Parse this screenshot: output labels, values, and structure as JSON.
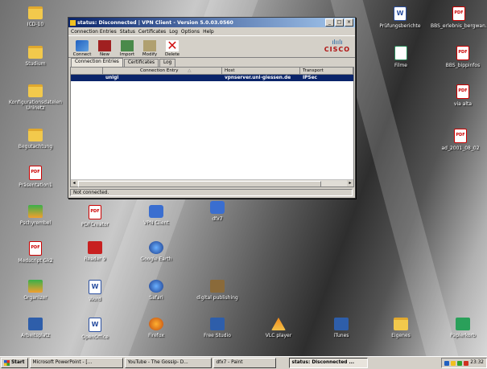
{
  "desktop": {
    "icons": [
      {
        "label": "ICD-10",
        "type": "folder"
      },
      {
        "label": "Studium",
        "type": "folder"
      },
      {
        "label": "Konfigurationsdateien Uninetz",
        "type": "folder"
      },
      {
        "label": "Begutachtung",
        "type": "folder"
      },
      {
        "label": "Präsentation1",
        "type": "pdf"
      },
      {
        "label": "Pschyrembel",
        "type": "green"
      },
      {
        "label": "PDFCreator",
        "type": "pdf"
      },
      {
        "label": "VPN Client",
        "type": "app"
      },
      {
        "label": "dfx7",
        "type": "app"
      },
      {
        "label": "Medscript Gk2",
        "type": "pdf"
      },
      {
        "label": "Reader 9",
        "type": "red"
      },
      {
        "label": "Google Earth",
        "type": "globe"
      },
      {
        "label": "Organizer",
        "type": "green"
      },
      {
        "label": "Word",
        "type": "doc"
      },
      {
        "label": "Safari",
        "type": "globe"
      },
      {
        "label": "digital publishing",
        "type": "brown"
      },
      {
        "label": "Arbeitsplatz",
        "type": "blue"
      },
      {
        "label": "OpenOffice",
        "type": "doc"
      },
      {
        "label": "Firefox",
        "type": "orange"
      },
      {
        "label": "Free Studio",
        "type": "blue"
      },
      {
        "label": "VLC player",
        "type": "cone"
      },
      {
        "label": "iTunes",
        "type": "blue"
      },
      {
        "label": "Eigenes",
        "type": "folder"
      },
      {
        "label": "Papierkorb",
        "type": "recycle"
      },
      {
        "label": "Prüfungsberichte",
        "type": "doc"
      },
      {
        "label": "BBS_erlebnis_bergwan...",
        "type": "pdf"
      },
      {
        "label": "Filme",
        "type": "pub"
      },
      {
        "label": "BBS_bippinfos",
        "type": "pdf"
      },
      {
        "label": "via alta",
        "type": "pdf"
      },
      {
        "label": "ad_2001_08_02",
        "type": "pdf"
      }
    ]
  },
  "window": {
    "title": "status: Disconnected | VPN Client - Version 5.0.03.0560",
    "controls": {
      "minimize": "_",
      "maximize": "□",
      "close": "×"
    },
    "menu": [
      "Connection Entries",
      "Status",
      "Certificates",
      "Log",
      "Options",
      "Help"
    ],
    "toolbar": [
      {
        "label": "Connect",
        "icon": "connect-icon"
      },
      {
        "label": "New",
        "icon": "new-icon"
      },
      {
        "label": "Import",
        "icon": "import-icon"
      },
      {
        "label": "Modify",
        "icon": "modify-icon"
      },
      {
        "label": "Delete",
        "icon": "delete-icon"
      }
    ],
    "brand": {
      "bars": "ılıılı",
      "name": "CISCO"
    },
    "tabs": [
      "Connection Entries",
      "Certificates",
      "Log"
    ],
    "active_tab": 0,
    "table": {
      "columns": [
        "",
        "Connection Entry",
        "Host",
        "Transport"
      ],
      "sort_indicator": "△",
      "rows": [
        {
          "status": "",
          "entry": "unigi",
          "host": "vpnserver.uni-giessen.de",
          "transport": "IPSec",
          "selected": true
        }
      ]
    },
    "status_text": "Not connected."
  },
  "taskbar": {
    "start_label": "Start",
    "tasks": [
      {
        "label": "Microsoft PowerPoint - [...",
        "active": false
      },
      {
        "label": "YouTube - The Gossip- D...",
        "active": false
      },
      {
        "label": "dfx7 - Paint",
        "active": false
      },
      {
        "label": "status: Disconnected ...",
        "active": true
      }
    ],
    "clock": "23:32"
  },
  "colors": {
    "title_start": "#0a246a",
    "title_end": "#a6caf0",
    "selection": "#0a246a",
    "cisco_red": "#b01010",
    "cisco_blue": "#1a5ea0"
  }
}
